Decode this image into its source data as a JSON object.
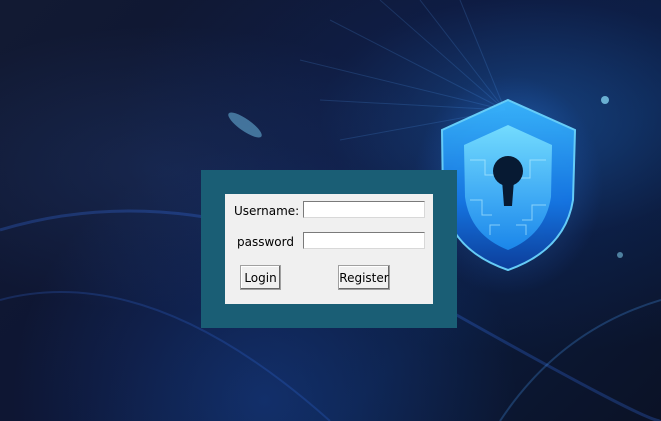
{
  "login_form": {
    "username_label": "Username:",
    "password_label": "password",
    "username_value": "",
    "password_value": "",
    "login_button": "Login",
    "register_button": "Register"
  },
  "colors": {
    "panel_background": "#1a5e75",
    "form_background": "#f0f0f0",
    "shield_glow": "#2fa8ff"
  },
  "icons": {
    "shield": "shield-keyhole-icon"
  }
}
